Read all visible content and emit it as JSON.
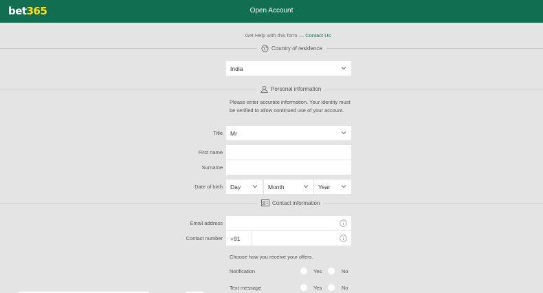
{
  "header": {
    "logo_part1": "bet",
    "logo_part2": "365",
    "title": "Open Account"
  },
  "help": {
    "text": "Get Help with this form — ",
    "link": "Contact Us"
  },
  "sections": {
    "country": "Country of residence",
    "personal": "Personal information",
    "contact": "Contact information"
  },
  "country": {
    "value": "India"
  },
  "personal": {
    "note": "Please enter accurate information. Your identity must be verified to allow continued use of your account.",
    "title_label": "Title",
    "title_value": "Mr",
    "first_name_label": "First name",
    "first_name_value": "",
    "surname_label": "Surname",
    "surname_value": "",
    "dob_label": "Date of birth",
    "dob_day": "Day",
    "dob_month": "Month",
    "dob_year": "Year"
  },
  "contact": {
    "email_label": "Email address",
    "email_value": "",
    "phone_label": "Contact number",
    "phone_code": "+91",
    "phone_value": ""
  },
  "offers": {
    "heading": "Choose how you receive your offers.",
    "rows": [
      {
        "label": "Notification",
        "yes": "Yes",
        "no": "No"
      },
      {
        "label": "Text message",
        "yes": "Yes",
        "no": "No"
      }
    ]
  },
  "colors": {
    "brand": "#126e51",
    "logo_accent": "#ffdf1b",
    "background": "#e4e4e4"
  }
}
